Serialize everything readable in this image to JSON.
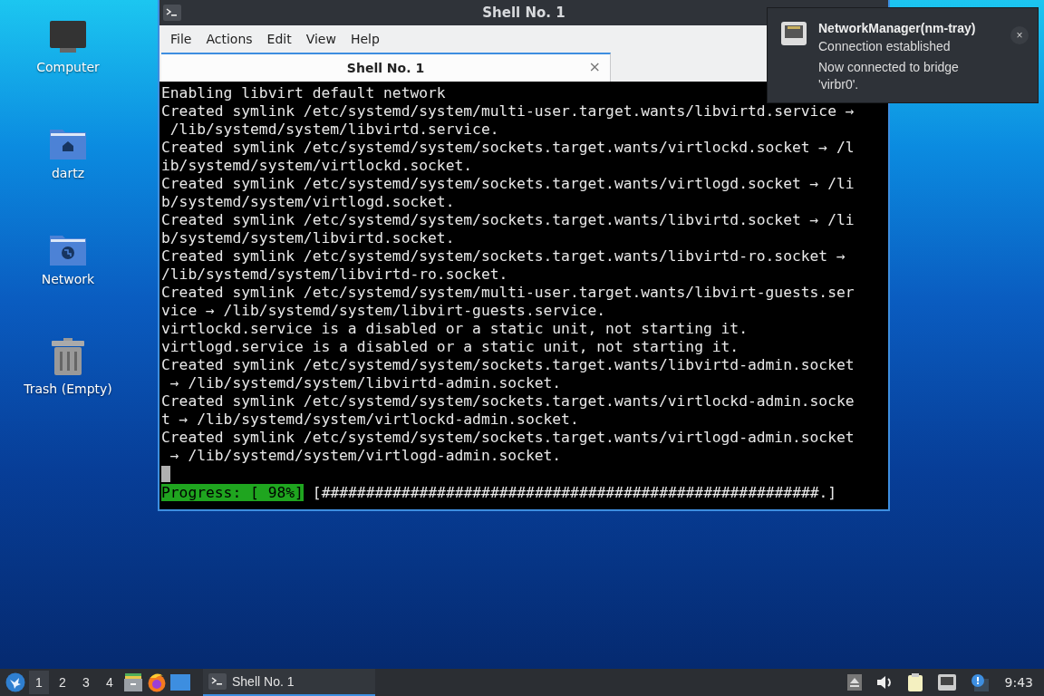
{
  "desktop_icons": [
    {
      "label": "Computer",
      "kind": "computer"
    },
    {
      "label": "dartz",
      "kind": "home"
    },
    {
      "label": "Network",
      "kind": "network"
    },
    {
      "label": "Trash (Empty)",
      "kind": "trash"
    }
  ],
  "terminal": {
    "title": "Shell No. 1",
    "menu": [
      "File",
      "Actions",
      "Edit",
      "View",
      "Help"
    ],
    "tabs": [
      {
        "label": "Shell No. 1",
        "selected": true,
        "close": "×"
      }
    ],
    "lines": [
      "Enabling libvirt default network",
      "Created symlink /etc/systemd/system/multi-user.target.wants/libvirtd.service →",
      " /lib/systemd/system/libvirtd.service.",
      "Created symlink /etc/systemd/system/sockets.target.wants/virtlockd.socket → /l",
      "ib/systemd/system/virtlockd.socket.",
      "Created symlink /etc/systemd/system/sockets.target.wants/virtlogd.socket → /li",
      "b/systemd/system/virtlogd.socket.",
      "Created symlink /etc/systemd/system/sockets.target.wants/libvirtd.socket → /li",
      "b/systemd/system/libvirtd.socket.",
      "Created symlink /etc/systemd/system/sockets.target.wants/libvirtd-ro.socket →",
      "/lib/systemd/system/libvirtd-ro.socket.",
      "Created symlink /etc/systemd/system/multi-user.target.wants/libvirt-guests.ser",
      "vice → /lib/systemd/system/libvirt-guests.service.",
      "virtlockd.service is a disabled or a static unit, not starting it.",
      "virtlogd.service is a disabled or a static unit, not starting it.",
      "Created symlink /etc/systemd/system/sockets.target.wants/libvirtd-admin.socket",
      " → /lib/systemd/system/libvirtd-admin.socket.",
      "Created symlink /etc/systemd/system/sockets.target.wants/virtlockd-admin.socke",
      "t → /lib/systemd/system/virtlockd-admin.socket.",
      "Created symlink /etc/systemd/system/sockets.target.wants/virtlogd-admin.socket",
      " → /lib/systemd/system/virtlogd-admin.socket."
    ],
    "progress": {
      "label": "Progress: [ 98%]",
      "bar": "[########################################################.]"
    }
  },
  "notification": {
    "app": "NetworkManager(nm-tray)",
    "summary": "Connection established",
    "body": "Now connected to bridge 'virbr0'.",
    "close": "×"
  },
  "taskbar": {
    "workspaces": [
      {
        "label": "1",
        "selected": true
      },
      {
        "label": "2",
        "selected": false
      },
      {
        "label": "3",
        "selected": false
      },
      {
        "label": "4",
        "selected": false
      }
    ],
    "tasks": [
      {
        "label": "Shell No. 1",
        "selected": true
      }
    ],
    "clock": "9:43"
  }
}
